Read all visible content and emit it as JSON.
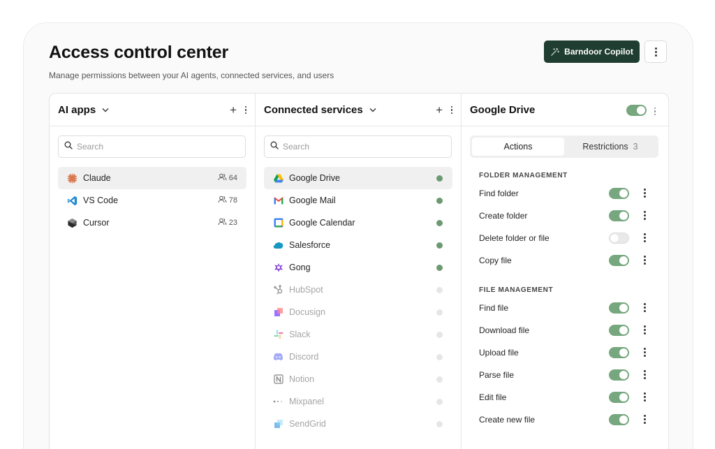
{
  "page": {
    "title": "Access control center",
    "subtitle": "Manage permissions between your AI agents, connected services, and users",
    "copilot_label": "Barndoor Copilot"
  },
  "ai_apps": {
    "title": "AI apps",
    "search_placeholder": "Search",
    "items": [
      {
        "label": "Claude",
        "count": "64",
        "icon": "claude-icon"
      },
      {
        "label": "VS Code",
        "count": "78",
        "icon": "vscode-icon"
      },
      {
        "label": "Cursor",
        "count": "23",
        "icon": "cursor-icon"
      }
    ]
  },
  "services": {
    "title": "Connected services",
    "search_placeholder": "Search",
    "items": [
      {
        "label": "Google Drive",
        "status": "connected"
      },
      {
        "label": "Google Mail",
        "status": "connected"
      },
      {
        "label": "Google Calendar",
        "status": "connected"
      },
      {
        "label": "Salesforce",
        "status": "connected"
      },
      {
        "label": "Gong",
        "status": "connected"
      },
      {
        "label": "HubSpot",
        "status": "disconnected"
      },
      {
        "label": "Docusign",
        "status": "disconnected"
      },
      {
        "label": "Slack",
        "status": "disconnected"
      },
      {
        "label": "Discord",
        "status": "disconnected"
      },
      {
        "label": "Notion",
        "status": "disconnected"
      },
      {
        "label": "Mixpanel",
        "status": "disconnected"
      },
      {
        "label": "SendGrid",
        "status": "disconnected"
      }
    ]
  },
  "detail": {
    "title": "Google Drive",
    "enabled": true,
    "tabs": {
      "actions": "Actions",
      "restrictions": "Restrictions",
      "restrictions_count": "3"
    },
    "sections": [
      {
        "title": "FOLDER MANAGEMENT",
        "actions": [
          {
            "label": "Find folder",
            "enabled": true
          },
          {
            "label": "Create folder",
            "enabled": true
          },
          {
            "label": "Delete folder or file",
            "enabled": false
          },
          {
            "label": "Copy file",
            "enabled": true
          }
        ]
      },
      {
        "title": "FILE MANAGEMENT",
        "actions": [
          {
            "label": "Find file",
            "enabled": true
          },
          {
            "label": "Download file",
            "enabled": true
          },
          {
            "label": "Upload file",
            "enabled": true
          },
          {
            "label": "Parse file",
            "enabled": true
          },
          {
            "label": "Edit file",
            "enabled": true
          },
          {
            "label": "Create new file",
            "enabled": true
          }
        ]
      }
    ]
  },
  "colors": {
    "primary": "#1f3d31",
    "toggle_on": "#76a77e",
    "status_on": "#6b9a72",
    "status_off": "#e6e6e6"
  }
}
